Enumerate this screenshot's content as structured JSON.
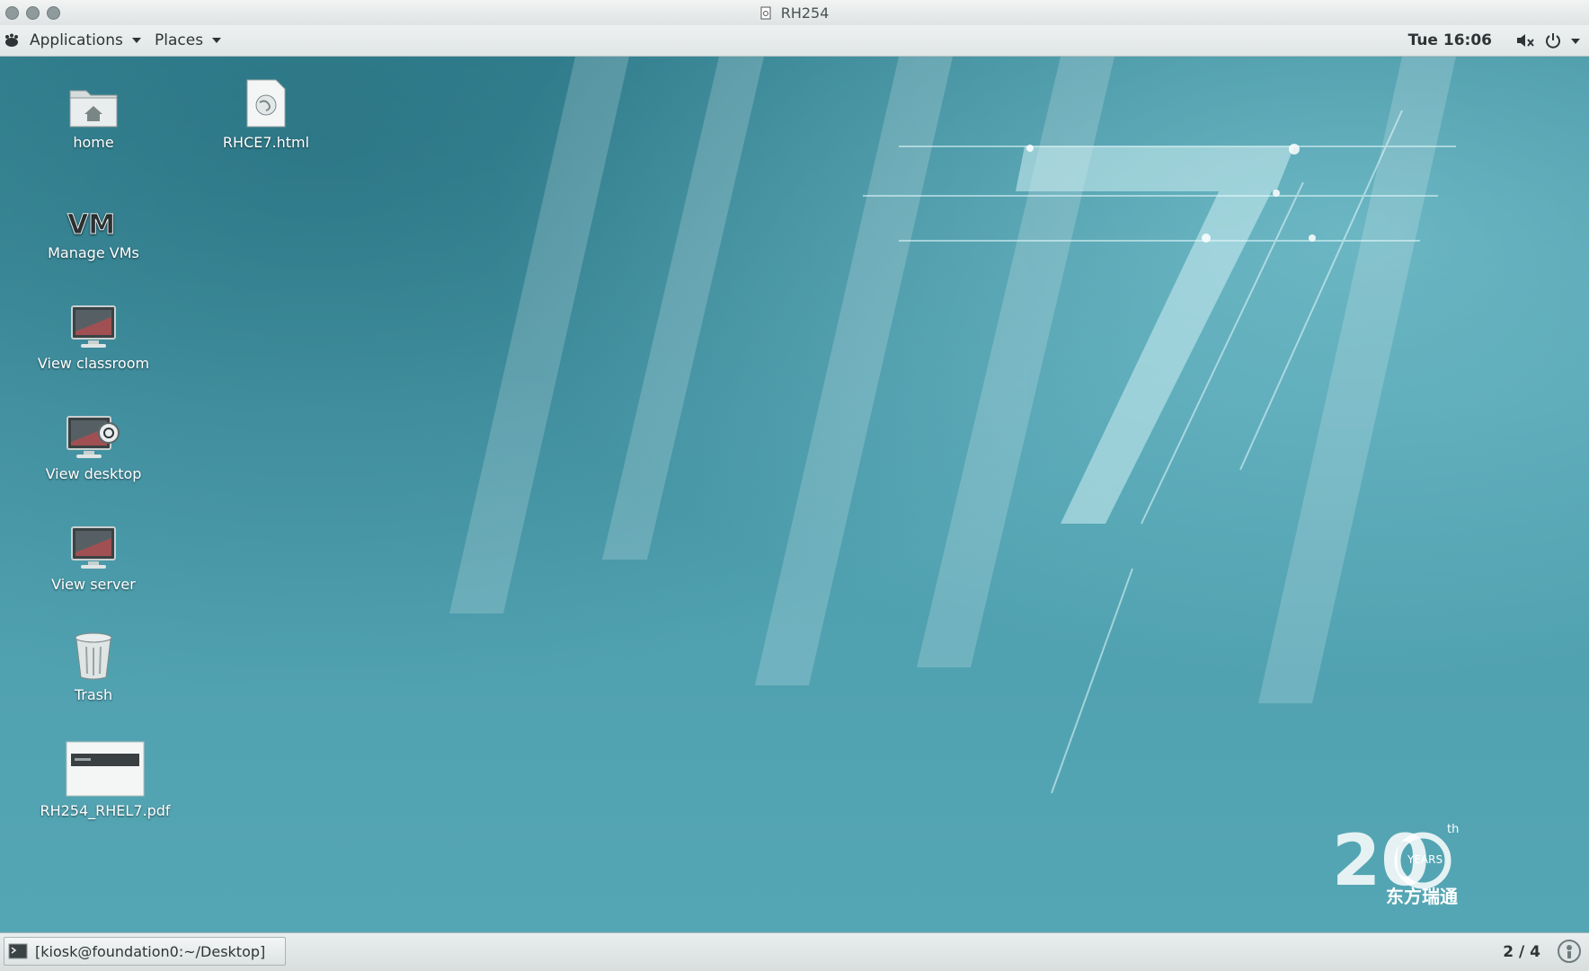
{
  "window": {
    "title": "RH254"
  },
  "top_panel": {
    "applications_label": "Applications",
    "places_label": "Places",
    "clock": "Tue 16:06"
  },
  "desktop": {
    "icons": [
      {
        "label": "home",
        "icon": "home-folder-icon"
      },
      {
        "label": "RHCE7.html",
        "icon": "html-file-icon"
      },
      {
        "label": "Manage VMs",
        "icon": "vm-icon"
      },
      {
        "label": "View classroom",
        "icon": "monitor-icon"
      },
      {
        "label": "View desktop",
        "icon": "monitor-icon"
      },
      {
        "label": "View server",
        "icon": "monitor-icon"
      },
      {
        "label": "Trash",
        "icon": "trash-icon"
      },
      {
        "label": "RH254_RHEL7.pdf",
        "icon": "pdf-thumbnail-icon"
      }
    ],
    "watermark": {
      "number": "20",
      "superscript": "th",
      "ring_text": "YEARS",
      "brand": "东方瑞通"
    }
  },
  "bottom_panel": {
    "task_label": "[kiosk@foundation0:~/Desktop]",
    "workspace_indicator": "2 / 4"
  },
  "colors": {
    "desktop": "#4f9fad",
    "panel": "#e4e8e8"
  }
}
